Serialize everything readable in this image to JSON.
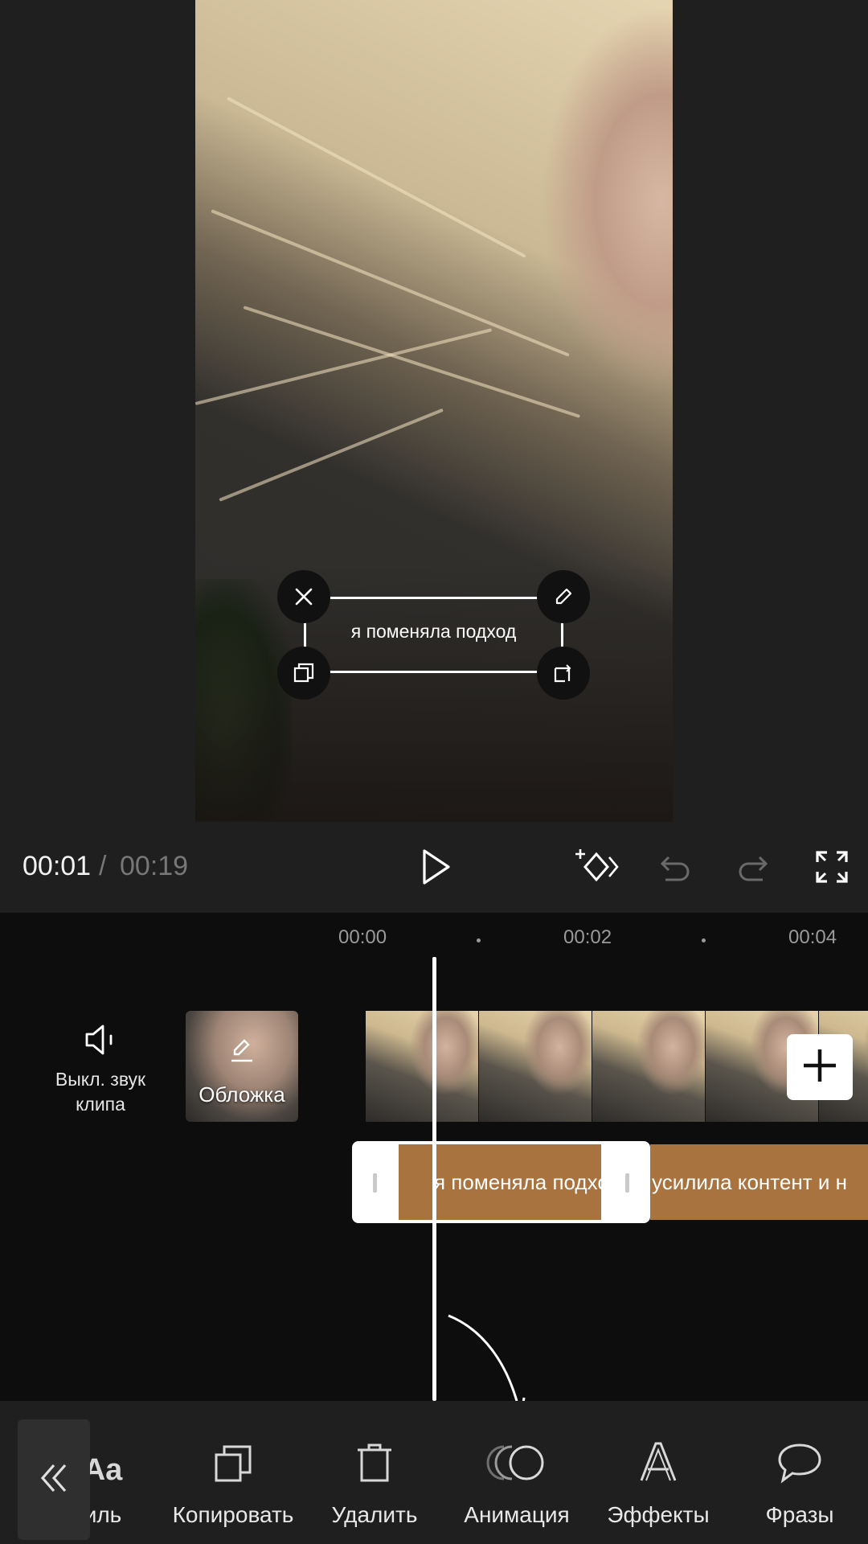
{
  "preview": {
    "overlay_text": "я поменяла подход"
  },
  "playback": {
    "current_time": "00:01",
    "separator": "/",
    "total_time": "00:19"
  },
  "controls": {
    "play": "play-icon",
    "keyframe": "add-keyframe-icon",
    "undo": "undo-icon",
    "redo": "redo-icon",
    "fullscreen": "fullscreen-icon"
  },
  "timeline": {
    "ruler": [
      "00:00",
      "00:02",
      "00:04"
    ],
    "mute_label": "Выкл. звук клипа",
    "cover_label": "Обложка",
    "text_clips": [
      {
        "text": "я поменяла подход"
      },
      {
        "text": "усилила контент и н"
      }
    ]
  },
  "toolbar": {
    "items": [
      {
        "label": "иль",
        "icon": "text-style-icon"
      },
      {
        "label": "Копировать",
        "icon": "copy-icon"
      },
      {
        "label": "Удалить",
        "icon": "delete-icon"
      },
      {
        "label": "Анимация",
        "icon": "animation-icon"
      },
      {
        "label": "Эффекты",
        "icon": "text-effects-icon"
      },
      {
        "label": "Фразы",
        "icon": "speech-bubble-icon"
      }
    ],
    "collapse": "double-chevron-left-icon",
    "partial_icon_text": "Aa"
  },
  "colors": {
    "accent_clip": "#a8733f",
    "background": "#0d0d0d",
    "panel": "#1f1f1f"
  }
}
